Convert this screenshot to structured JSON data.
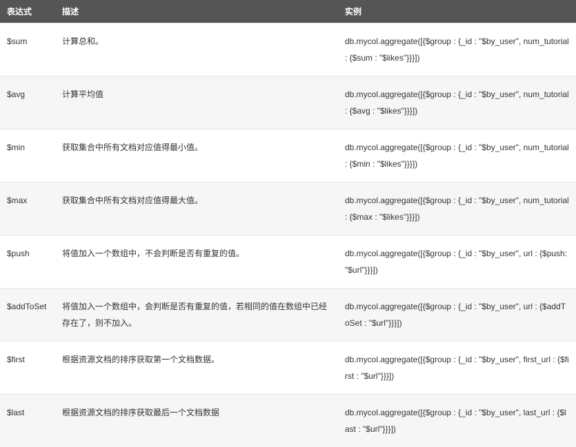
{
  "headers": {
    "expression": "表达式",
    "description": "描述",
    "example": "实例"
  },
  "rows": [
    {
      "expression": "$sum",
      "description": "计算总和。",
      "example": "db.mycol.aggregate([{$group : {_id : \"$by_user\", num_tutorial : {$sum : \"$likes\"}}}])"
    },
    {
      "expression": "$avg",
      "description": "计算平均值",
      "example": "db.mycol.aggregate([{$group : {_id : \"$by_user\", num_tutorial : {$avg : \"$likes\"}}}])"
    },
    {
      "expression": "$min",
      "description": "获取集合中所有文档对应值得最小值。",
      "example": "db.mycol.aggregate([{$group : {_id : \"$by_user\", num_tutorial : {$min : \"$likes\"}}}])"
    },
    {
      "expression": "$max",
      "description": "获取集合中所有文档对应值得最大值。",
      "example": "db.mycol.aggregate([{$group : {_id : \"$by_user\", num_tutorial : {$max : \"$likes\"}}}])"
    },
    {
      "expression": "$push",
      "description": "将值加入一个数组中，不会判断是否有重复的值。",
      "example": "db.mycol.aggregate([{$group : {_id : \"$by_user\", url : {$push: \"$url\"}}}])"
    },
    {
      "expression": "$addToSet",
      "description": "将值加入一个数组中，会判断是否有重复的值，若相同的值在数组中已经存在了，则不加入。",
      "example": "db.mycol.aggregate([{$group : {_id : \"$by_user\", url : {$addToSet : \"$url\"}}}])"
    },
    {
      "expression": "$first",
      "description": "根据资源文档的排序获取第一个文档数据。",
      "example": "db.mycol.aggregate([{$group : {_id : \"$by_user\", first_url : {$first : \"$url\"}}}])"
    },
    {
      "expression": "$last",
      "description": "根据资源文档的排序获取最后一个文档数据",
      "example": "db.mycol.aggregate([{$group : {_id : \"$by_user\", last_url : {$last : \"$url\"}}}])"
    }
  ]
}
